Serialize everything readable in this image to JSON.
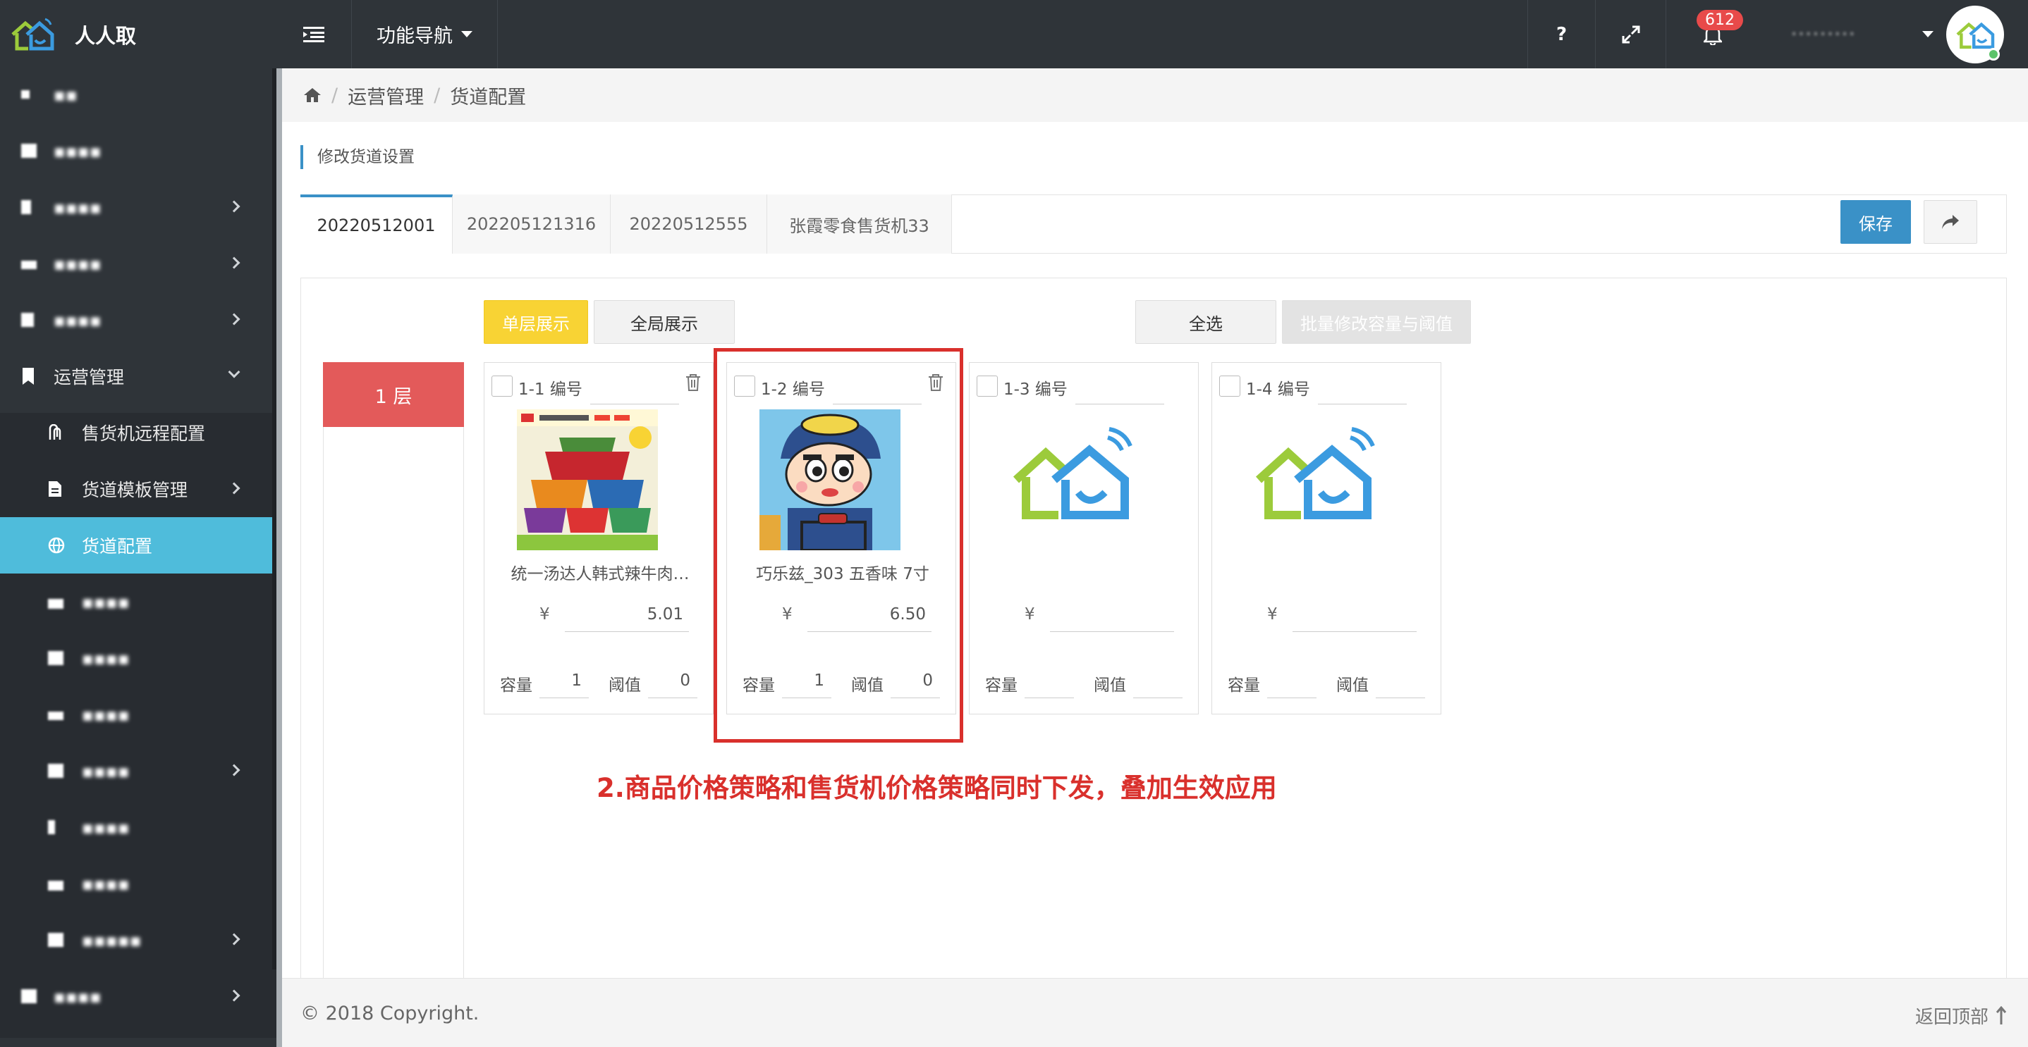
{
  "app": {
    "name": "人人取",
    "nav_label": "功能导航",
    "help": "?",
    "notification_count": "612",
    "user_name": "·········"
  },
  "sidebar": {
    "items": [
      {
        "label": "▪▪",
        "blurred": true
      },
      {
        "label": "▪▪▪▪",
        "blurred": true
      },
      {
        "label": "▪▪▪▪",
        "blurred": true
      },
      {
        "label": "▪▪▪▪",
        "blurred": true
      },
      {
        "label": "▪▪▪▪",
        "blurred": true
      },
      {
        "label": "运营管理"
      },
      {
        "label": "售货机远程配置"
      },
      {
        "label": "货道模板管理"
      },
      {
        "label": "货道配置"
      },
      {
        "label": "▪▪▪▪",
        "blurred": true
      },
      {
        "label": "▪▪▪▪",
        "blurred": true
      },
      {
        "label": "▪▪▪▪",
        "blurred": true
      },
      {
        "label": "▪▪▪▪",
        "blurred": true
      },
      {
        "label": "▪▪▪▪",
        "blurred": true
      },
      {
        "label": "▪▪▪▪",
        "blurred": true
      },
      {
        "label": "▪▪▪▪▪",
        "blurred": true
      },
      {
        "label": "▪▪▪▪",
        "blurred": true
      }
    ]
  },
  "breadcrumb": [
    "运营管理",
    "货道配置"
  ],
  "panel_title": "修改货道设置",
  "tabs": [
    "20220512001",
    "202205121316",
    "20220512555",
    "张霞零食售货机33"
  ],
  "actions": {
    "save": "保存"
  },
  "toolbar": {
    "single": "单层展示",
    "global": "全局展示",
    "select_all": "全选",
    "batch": "批量修改容量与阈值"
  },
  "layer": "1 层",
  "slots": [
    {
      "label": "1-1 编号",
      "name": "统一汤达人韩式辣牛肉…",
      "currency": "¥",
      "price": "5.01",
      "cap_label": "容量",
      "capacity": "1",
      "thr_label": "阈值",
      "threshold": "0",
      "image": "noodle-cups"
    },
    {
      "label": "1-2 编号",
      "name": "巧乐兹_303 五香味 7寸",
      "currency": "¥",
      "price": "6.50",
      "cap_label": "容量",
      "capacity": "1",
      "thr_label": "阈值",
      "threshold": "0",
      "image": "cartoon-boy"
    },
    {
      "label": "1-3 编号",
      "name": "",
      "currency": "¥",
      "price": "",
      "cap_label": "容量",
      "capacity": "",
      "thr_label": "阈值",
      "threshold": "",
      "image": "placeholder-logo"
    },
    {
      "label": "1-4 编号",
      "name": "",
      "currency": "¥",
      "price": "",
      "cap_label": "容量",
      "capacity": "",
      "thr_label": "阈值",
      "threshold": "",
      "image": "placeholder-logo"
    }
  ],
  "annotation": "2.商品价格策略和售货机价格策略同时下发，叠加生效应用",
  "footer": {
    "copyright": "© 2018 Copyright.",
    "back_to_top": "返回顶部"
  },
  "colors": {
    "topbar": "#2f3439",
    "accent": "#3a91c7",
    "active_nav": "#4fbcdb",
    "layer": "#e35a5a",
    "single_btn": "#f8d334",
    "annotation": "#d9302c"
  }
}
